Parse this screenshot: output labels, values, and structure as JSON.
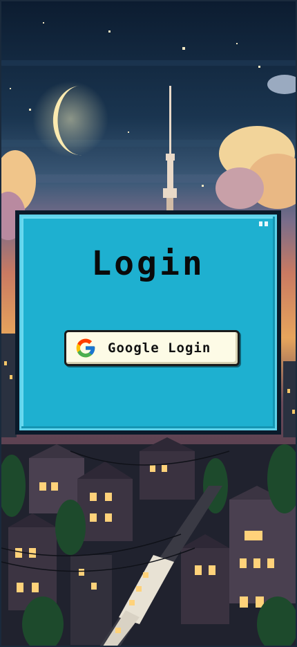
{
  "login": {
    "title": "Login",
    "google_button_label": "Google Login",
    "google_icon": "google-g-icon"
  },
  "colors": {
    "panel": "#1eb0d0",
    "panel_border": "#0a1a2a",
    "button_bg": "#fdfbe6",
    "sky_top": "#0e1f33",
    "sky_bottom": "#e0924e"
  }
}
